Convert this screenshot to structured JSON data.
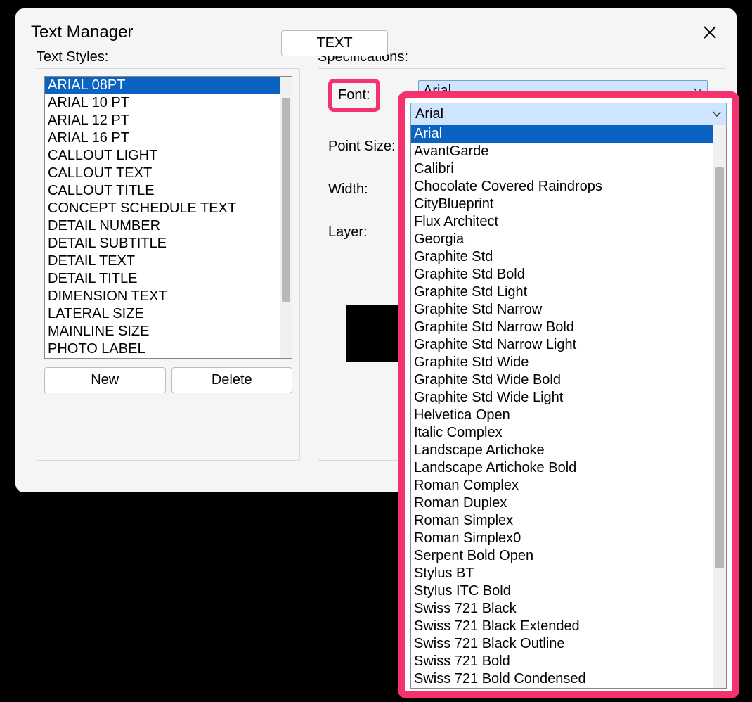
{
  "dialog": {
    "title": "Text Manager"
  },
  "text_styles": {
    "label": "Text Styles:",
    "items": [
      "ARIAL 08PT",
      "ARIAL 10 PT",
      "ARIAL 12 PT",
      "ARIAL 16 PT",
      "CALLOUT LIGHT",
      "CALLOUT TEXT",
      "CALLOUT TITLE",
      "CONCEPT SCHEDULE TEXT",
      "DETAIL NUMBER",
      "DETAIL SUBTITLE",
      "DETAIL TEXT",
      "DETAIL TITLE",
      "DIMENSION TEXT",
      "LATERAL SIZE",
      "MAINLINE SIZE",
      "PHOTO LABEL"
    ],
    "selected_index": 0,
    "new_label": "New",
    "delete_label": "Delete"
  },
  "specs": {
    "label": "Specifications:",
    "font_label": "Font:",
    "font_value": "Arial",
    "point_size_label": "Point Size:",
    "width_label": "Width:",
    "layer_label": "Layer:"
  },
  "bottom": {
    "text_label": "TEXT"
  },
  "font_dropdown": {
    "header_value": "Arial",
    "options": [
      "Arial",
      "AvantGarde",
      "Calibri",
      "Chocolate Covered Raindrops",
      "CityBlueprint",
      "Flux Architect",
      "Georgia",
      "Graphite Std",
      "Graphite Std Bold",
      "Graphite Std Light",
      "Graphite Std Narrow",
      "Graphite Std Narrow Bold",
      "Graphite Std Narrow Light",
      "Graphite Std Wide",
      "Graphite Std Wide Bold",
      "Graphite Std Wide Light",
      "Helvetica Open",
      "Italic Complex",
      "Landscape Artichoke",
      "Landscape Artichoke Bold",
      "Roman Complex",
      "Roman Duplex",
      "Roman Simplex",
      "Roman Simplex0",
      "Serpent Bold Open",
      "Stylus BT",
      "Stylus ITC Bold",
      "Swiss 721 Black",
      "Swiss 721 Black Extended",
      "Swiss 721 Black Outline",
      "Swiss 721 Bold",
      "Swiss 721 Bold Condensed"
    ],
    "selected_index": 0
  }
}
